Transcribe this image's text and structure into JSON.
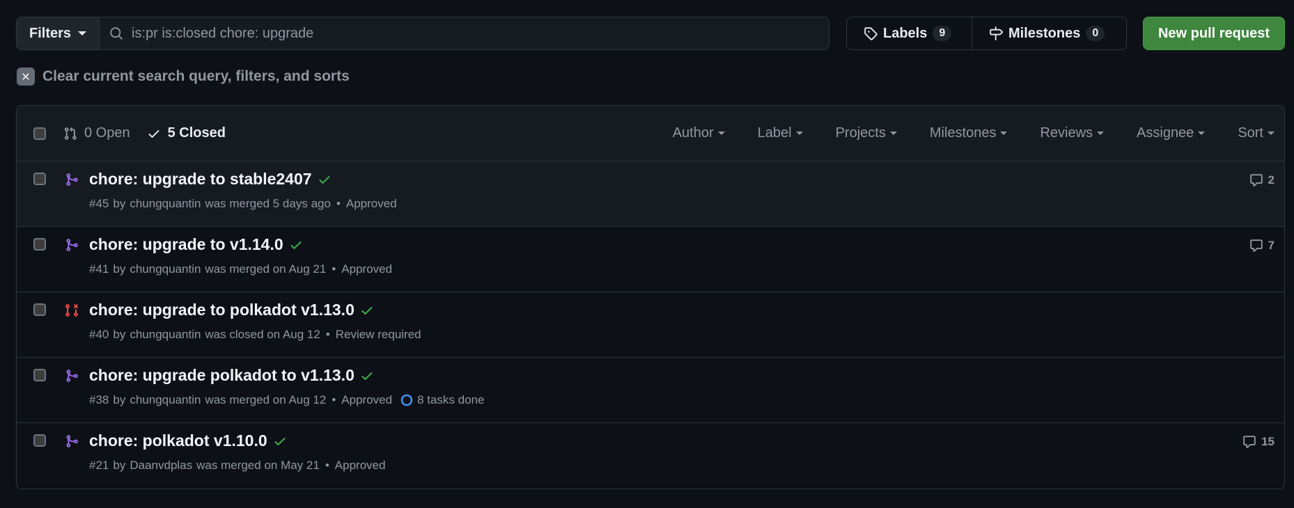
{
  "toolbar": {
    "filters_label": "Filters",
    "search_value": "is:pr is:closed chore: upgrade",
    "labels_label": "Labels",
    "labels_count": "9",
    "milestones_label": "Milestones",
    "milestones_count": "0",
    "new_pr_label": "New pull request"
  },
  "clear": {
    "label": "Clear current search query, filters, and sorts"
  },
  "header": {
    "open_label": "0 Open",
    "closed_label": "5 Closed",
    "menus": [
      "Author",
      "Label",
      "Projects",
      "Milestones",
      "Reviews",
      "Assignee",
      "Sort"
    ]
  },
  "colors": {
    "merged": "#a371f7",
    "closed": "#f85149",
    "check": "#3fb950",
    "accent_green": "#3f873f",
    "task_ring": "#4493f8"
  },
  "pulls": [
    {
      "title": "chore: upgrade to stable2407",
      "number": "#45",
      "author": "chungquantin",
      "state": "merged",
      "status_text": "was merged 5 days ago",
      "review": "Approved",
      "tasks": null,
      "comments": "2",
      "icon": "git-merge-icon"
    },
    {
      "title": "chore: upgrade to v1.14.0",
      "number": "#41",
      "author": "chungquantin",
      "state": "merged",
      "status_text": "was merged on Aug 21",
      "review": "Approved",
      "tasks": null,
      "comments": "7",
      "icon": "git-merge-icon"
    },
    {
      "title": "chore: upgrade to polkadot v1.13.0",
      "number": "#40",
      "author": "chungquantin",
      "state": "closed",
      "status_text": "was closed on Aug 12",
      "review": "Review required",
      "tasks": null,
      "comments": null,
      "icon": "git-pull-request-closed-icon"
    },
    {
      "title": "chore: upgrade polkadot to v1.13.0",
      "number": "#38",
      "author": "chungquantin",
      "state": "merged",
      "status_text": "was merged on Aug 12",
      "review": "Approved",
      "tasks": "8 tasks done",
      "comments": null,
      "icon": "git-merge-icon"
    },
    {
      "title": "chore: polkadot v1.10.0",
      "number": "#21",
      "author": "Daanvdplas",
      "state": "merged",
      "status_text": "was merged on May 21",
      "review": "Approved",
      "tasks": null,
      "comments": "15",
      "icon": "git-merge-icon"
    }
  ]
}
